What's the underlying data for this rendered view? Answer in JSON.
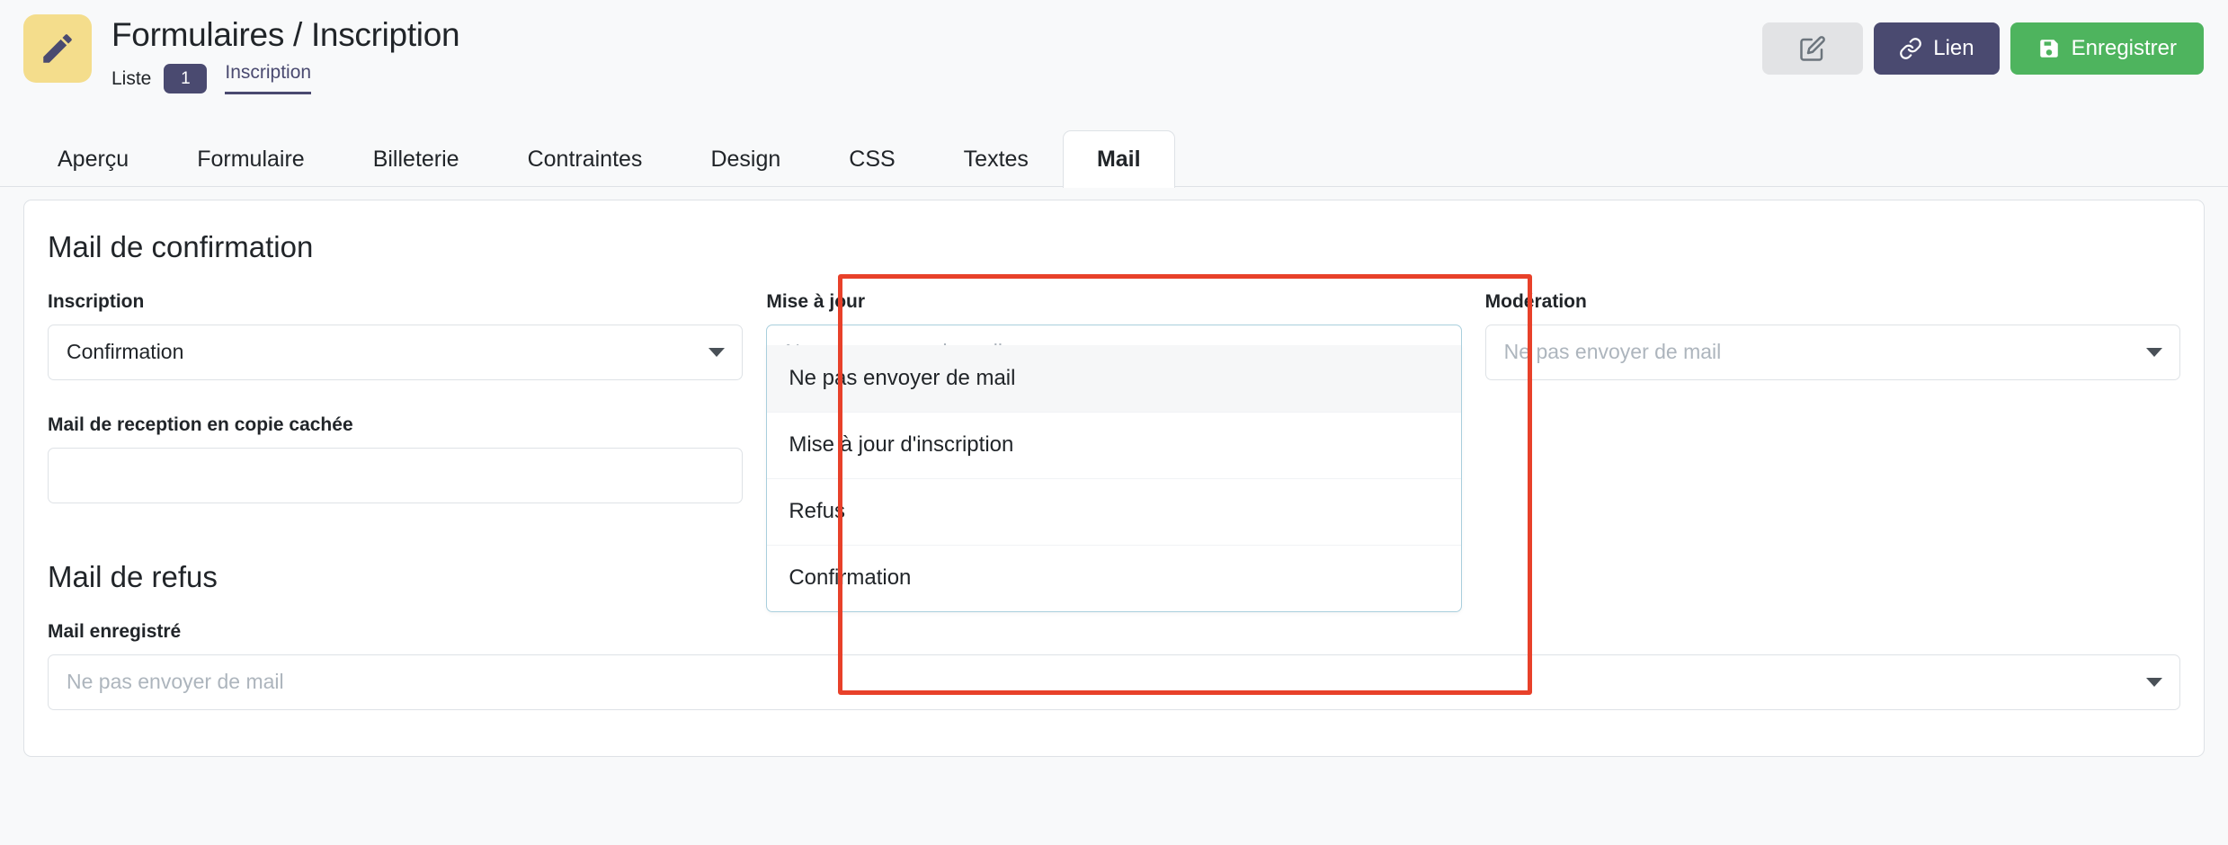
{
  "header": {
    "app_icon": "pencil-icon",
    "title": "Formulaires / Inscription",
    "breadcrumb": {
      "parent": "Liste",
      "count": "1",
      "current": "Inscription"
    },
    "actions": {
      "edit_icon": "edit-square-icon",
      "link_label": "Lien",
      "link_icon": "link-icon",
      "save_label": "Enregistrer",
      "save_icon": "floppy-disk-icon"
    },
    "colors": {
      "app_icon_bg": "#f4dd8c",
      "app_icon_fg": "#4a4a70",
      "accent": "#4a4a70",
      "save_bg": "#4eb45e",
      "annotation": "#e8412a"
    }
  },
  "tabs": [
    {
      "label": "Aperçu",
      "active": false
    },
    {
      "label": "Formulaire",
      "active": false
    },
    {
      "label": "Billeterie",
      "active": false
    },
    {
      "label": "Contraintes",
      "active": false
    },
    {
      "label": "Design",
      "active": false
    },
    {
      "label": "CSS",
      "active": false
    },
    {
      "label": "Textes",
      "active": false
    },
    {
      "label": "Mail",
      "active": true
    }
  ],
  "main": {
    "section_confirmation": {
      "title": "Mail de confirmation",
      "inscription": {
        "label": "Inscription",
        "value": "Confirmation",
        "is_placeholder": false
      },
      "mise_a_jour": {
        "label": "Mise à jour",
        "value": "Ne pas envoyer de mail",
        "is_placeholder": true,
        "open": true,
        "options": [
          {
            "label": "Ne pas envoyer de mail",
            "highlighted": true
          },
          {
            "label": "Mise à jour d'inscription",
            "highlighted": false
          },
          {
            "label": "Refus",
            "highlighted": false
          },
          {
            "label": "Confirmation",
            "highlighted": false
          }
        ]
      },
      "moderation": {
        "label": "Modération",
        "value": "Ne pas envoyer de mail",
        "is_placeholder": true
      },
      "copie_cachee": {
        "label": "Mail de reception en copie cachée",
        "value": "",
        "placeholder": ""
      }
    },
    "section_refus": {
      "title": "Mail de refus",
      "mail_enregistre": {
        "label": "Mail enregistré",
        "value": "Ne pas envoyer de mail",
        "is_placeholder": true
      }
    }
  }
}
